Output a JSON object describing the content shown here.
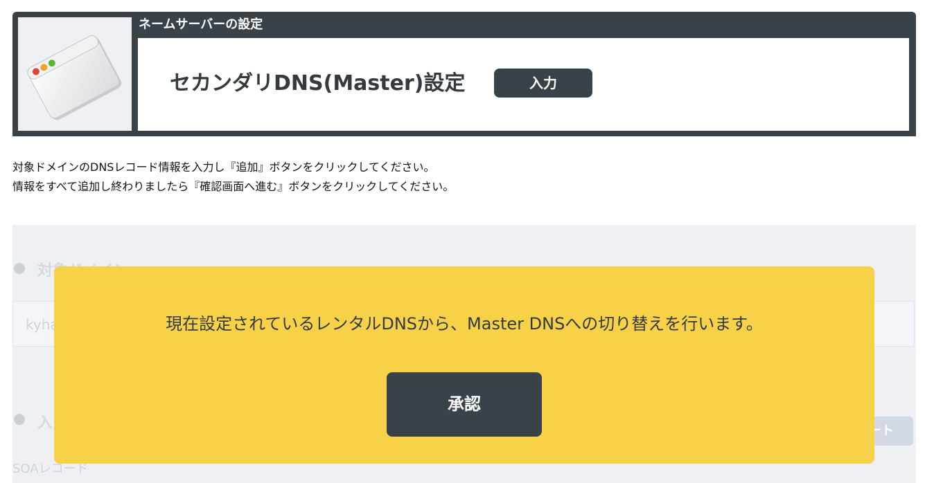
{
  "header": {
    "section_title": "ネームサーバーの設定",
    "page_title": "セカンダリDNS(Master)設定",
    "mode_badge": "入力",
    "icon": "browser-window-icon"
  },
  "instructions": {
    "line1": "対象ドメインのDNSレコード情報を入力し『追加』ボタンをクリックしてください。",
    "line2": "情報をすべて追加し終わりましたら『確認画面へ進む』ボタンをクリックしてください。"
  },
  "form": {
    "section1_label": "対象ドメイン",
    "domain_value": "kyha",
    "section2_label": "入",
    "faded_button_label": "ート",
    "soa_label": "SOAレコード"
  },
  "modal": {
    "message": "現在設定されているレンタルDNSから、Master DNSへの切り替えを行います。",
    "approve_label": "承認"
  },
  "colors": {
    "dark": "#3a4249",
    "modal_bg": "#f7d148",
    "form_bg": "#eef0f4"
  }
}
